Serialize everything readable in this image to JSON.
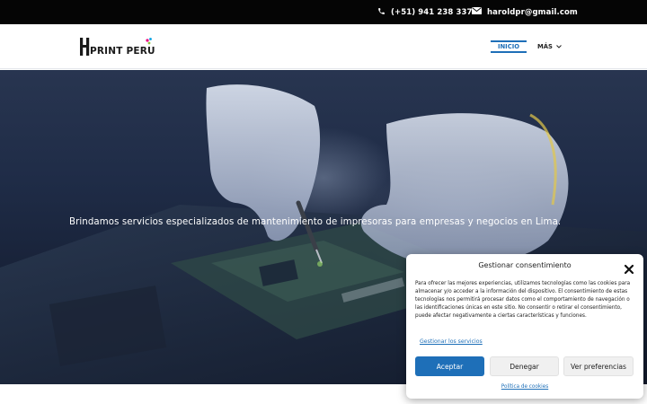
{
  "topbar": {
    "phone": "(+51) 941 238 337",
    "email": "haroldpr@gmail.com",
    "phone_icon": "phone-icon",
    "email_icon": "envelope-icon"
  },
  "header": {
    "logo_text": "PRINT PERU",
    "nav": {
      "inicio": "INICIO",
      "mas": "MÁS"
    }
  },
  "hero": {
    "text": "Brindamos servicios especializados de mantenimiento de impresoras para empresas y negocios en Lima."
  },
  "consent": {
    "title": "Gestionar consentimiento",
    "body": "Para ofrecer las mejores experiencias, utilizamos tecnologías como las cookies para almacenar y/o acceder a la información del dispositivo. El consentimiento de estas tecnologías nos permitirá procesar datos como el comportamiento de navegación o las identificaciones únicas en este sitio. No consentir o retirar el consentimiento, puede afectar negativamente a ciertas características y funciones.",
    "manage_link": "Gestionar los servicios",
    "accept": "Aceptar",
    "deny": "Denegar",
    "preferences": "Ver preferencias",
    "policy_link": "Política de cookies"
  },
  "colors": {
    "accent": "#1e6fb8",
    "topbar_bg": "#050505"
  }
}
